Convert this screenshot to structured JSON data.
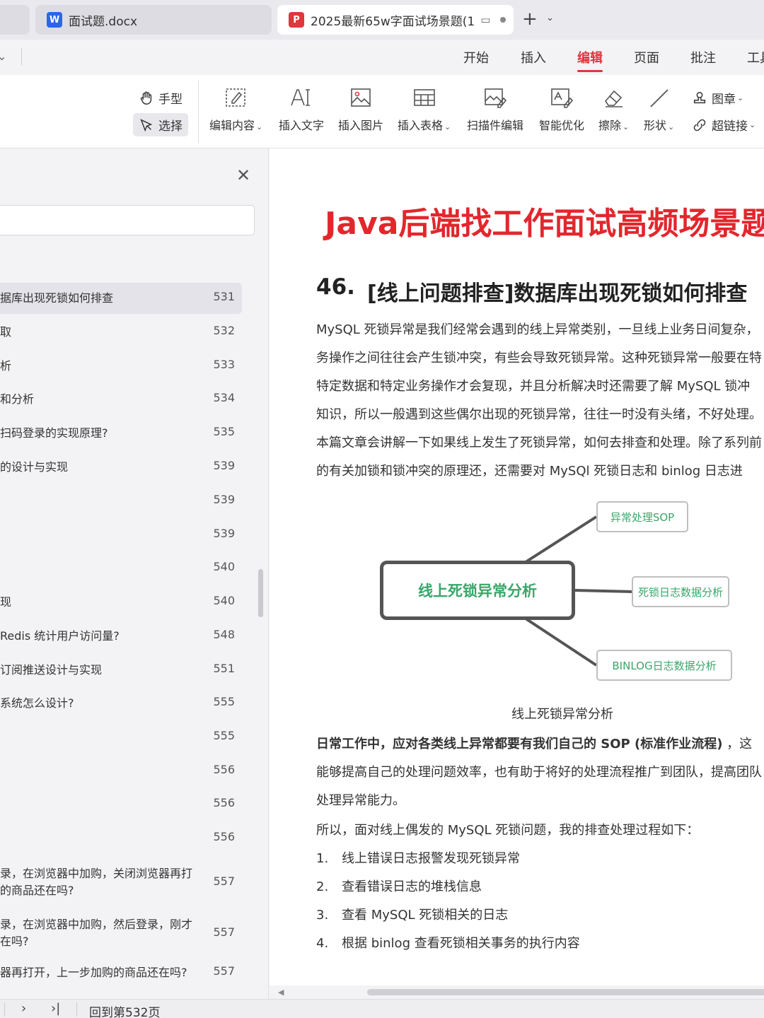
{
  "tabs": [
    {
      "title": "面试题.docx",
      "icon": "W"
    },
    {
      "title": "2025最新65w字面试场景题(1",
      "icon": "P"
    }
  ],
  "menu": [
    "开始",
    "插入",
    "编辑",
    "页面",
    "批注",
    "工具"
  ],
  "menu_active": "编辑",
  "ribbon": {
    "hand": "手型",
    "select": "选择",
    "tools": [
      "编辑内容",
      "插入文字",
      "插入图片",
      "插入表格",
      "扫描件编辑",
      "智能优化",
      "擦除",
      "形状"
    ],
    "seal": "图章",
    "hyperlink": "超链接"
  },
  "outline": {
    "search_placeholder": "",
    "items": [
      {
        "text": "据库出现死锁如何排查",
        "page": "531"
      },
      {
        "text": "取",
        "page": "532"
      },
      {
        "text": "析",
        "page": "533"
      },
      {
        "text": "和分析",
        "page": "534"
      },
      {
        "text": "扫码登录的实现原理?",
        "page": "535"
      },
      {
        "text": "的设计与实现",
        "page": "539"
      },
      {
        "text": "",
        "page": "539"
      },
      {
        "text": "",
        "page": "539"
      },
      {
        "text": "",
        "page": "540"
      },
      {
        "text": "现",
        "page": "540"
      },
      {
        "text": "Redis 统计用户访问量?",
        "page": "548"
      },
      {
        "text": "订阅推送设计与实现",
        "page": "551"
      },
      {
        "text": "系统怎么设计?",
        "page": "555"
      },
      {
        "text": "",
        "page": "555"
      },
      {
        "text": "",
        "page": "556"
      },
      {
        "text": "",
        "page": "556"
      },
      {
        "text": "",
        "page": "556"
      },
      {
        "text": "录，在浏览器中加购，关闭浏览器再打\n的商品还在吗?",
        "page": "557"
      },
      {
        "text": "录，在浏览器中加购，然后登录，刚才\n在吗?",
        "page": "557"
      },
      {
        "text": "器再打开，上一步加购的商品还在吗?",
        "page": "557"
      }
    ]
  },
  "document": {
    "title": "Java后端找工作面试高频场景题",
    "section_number": "46.",
    "section_title": "[线上问题排查]数据库出现死锁如何排查",
    "intro_lines": [
      "MySQL 死锁异常是我们经常会遇到的线上异常类别，一旦线上业务日间复杂，",
      "务操作之间往往会产生锁冲突，有些会导致死锁异常。这种死锁异常一般要在特",
      "特定数据和特定业务操作才会复现，并且分析解决时还需要了解 MySQL 锁冲",
      "知识，所以一般遇到这些偶尔出现的死锁异常，往往一时没有头绪，不好处理。",
      "本篇文章会讲解一下如果线上发生了死锁异常，如何去排查和处理。除了系列前",
      "的有关加锁和锁冲突的原理还，还需要对 MySQl 死锁日志和 binlog 日志进"
    ],
    "diagram": {
      "main": "线上死锁异常分析",
      "branches": [
        "异常处理SOP",
        "死锁日志数据分析",
        "BINLOG日志数据分析"
      ]
    },
    "caption": "线上死锁异常分析",
    "sop_bold": "日常工作中，应对各类线上异常都要有我们自己的 SOP (标准作业流程)",
    "sop_rest": " ，这",
    "sop_line2": "能够提高自己的处理问题效率，也有助于将好的处理流程推广到团队，提高团队",
    "sop_line3": "处理异常能力。",
    "process_intro": "所以，面对线上偶发的 MySQL 死锁问题，我的排查处理过程如下：",
    "steps": [
      {
        "n": "1.",
        "text": "线上错误日志报警发现死锁异常"
      },
      {
        "n": "2.",
        "text": "查看错误日志的堆栈信息"
      },
      {
        "n": "3.",
        "text": "查看 MySQL 死锁相关的日志"
      },
      {
        "n": "4.",
        "text": "根据 binlog 查看死锁相关事务的执行内容"
      }
    ]
  },
  "status": {
    "goto_page": "回到第532页"
  },
  "colors": {
    "accent": "#e0363d",
    "title_red": "#e3262d",
    "diagram_green": "#3aa66a"
  }
}
